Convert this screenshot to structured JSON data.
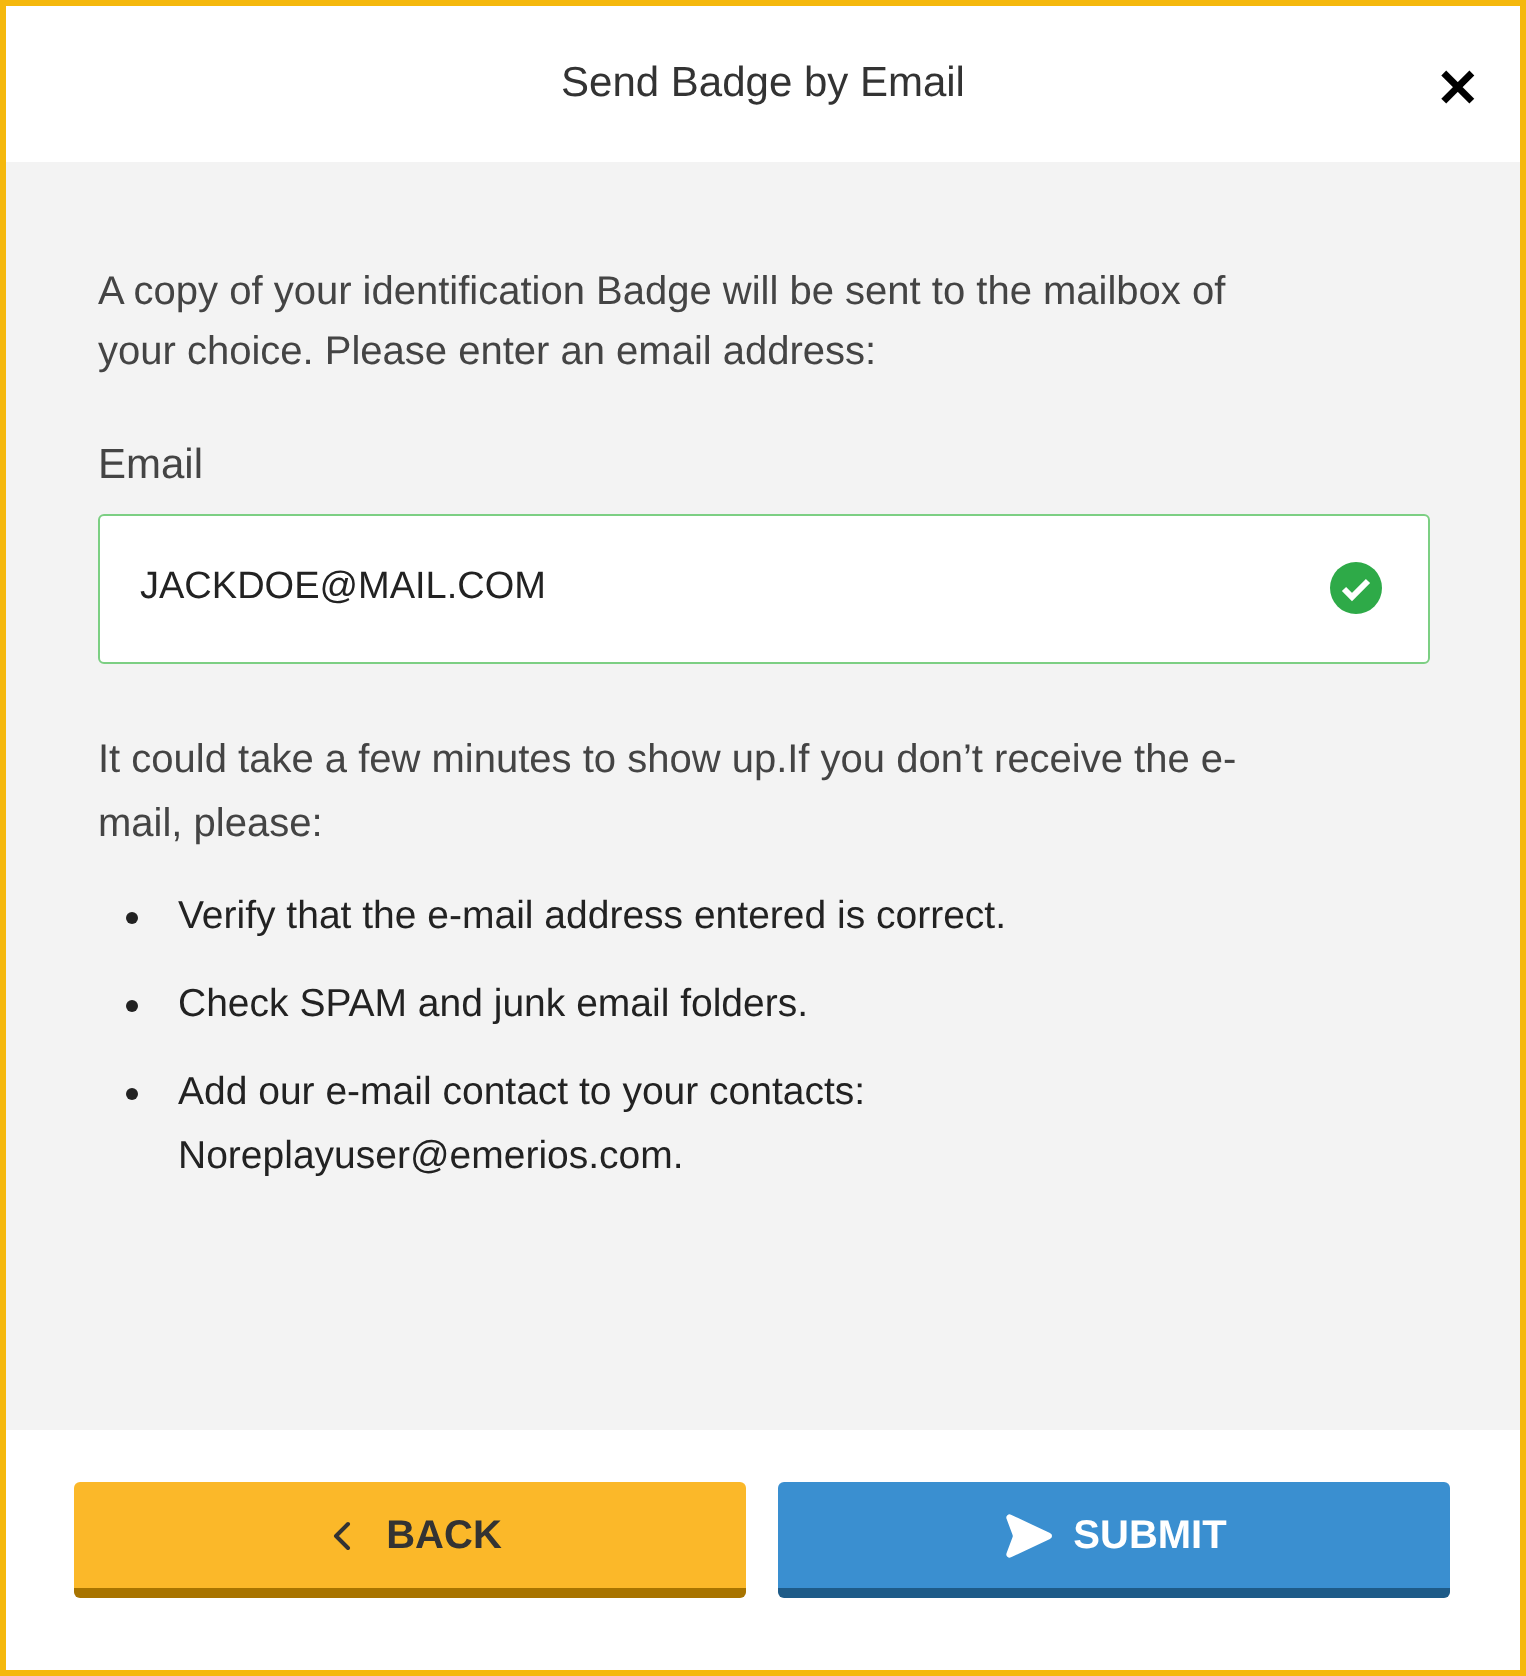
{
  "dialog": {
    "title": "Send Badge by Email",
    "close": "✕"
  },
  "intro": "A copy of your identification Badge will be sent to the mailbox of your choice. Please enter an email address:",
  "email": {
    "label": "Email",
    "value": "JACKDOE@MAIL.COM",
    "valid": true
  },
  "note": "It could take a few minutes to show up.If you don’t receive the e-mail, please:",
  "steps": [
    {
      "lines": [
        "Verify that the e-mail address entered is correct."
      ]
    },
    {
      "lines": [
        "Check SPAM and junk email folders."
      ]
    },
    {
      "lines": [
        "Add our e-mail contact to your contacts:",
        "Noreplayuser@emerios.com."
      ]
    }
  ],
  "buttons": [
    {
      "label": "BACK",
      "kind": "back"
    },
    {
      "label": "SUBMIT",
      "kind": "submit"
    }
  ]
}
